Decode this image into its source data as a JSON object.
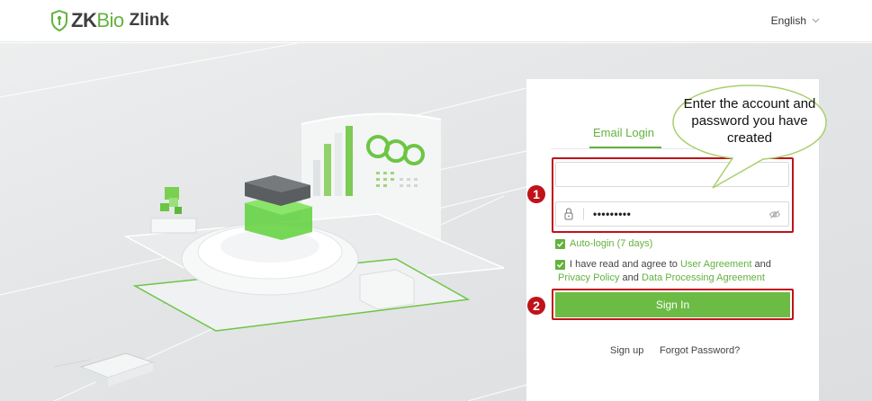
{
  "brand": {
    "logo_zk": "ZK",
    "logo_bio": "Bio",
    "logo_zlink": "Zlink",
    "accent_color": "#63b23e"
  },
  "header": {
    "language": "English",
    "language_icon": "chevron-down-icon"
  },
  "login": {
    "tab_email": "Email Login",
    "email_value": "",
    "password_mask": "•••••••••",
    "password_icon": "lock-icon",
    "show_password_icon": "eye-off-icon",
    "auto_login_label": "Auto-login (7 days)",
    "auto_login_checked": true,
    "agree_checked": true,
    "agree_text_1": "I have read and agree to",
    "user_agreement": "User Agreement",
    "agree_and_1": "and",
    "privacy_policy": "Privacy Policy",
    "agree_and_2": "and",
    "data_processing": "Data Processing Agreement",
    "sign_in": "Sign In",
    "sign_up": "Sign up",
    "forgot_password": "Forgot Password?"
  },
  "annotations": {
    "bubble_text": "Enter the account and password you have created",
    "step_1": "1",
    "step_2": "2",
    "highlight_color": "#c0121a"
  }
}
